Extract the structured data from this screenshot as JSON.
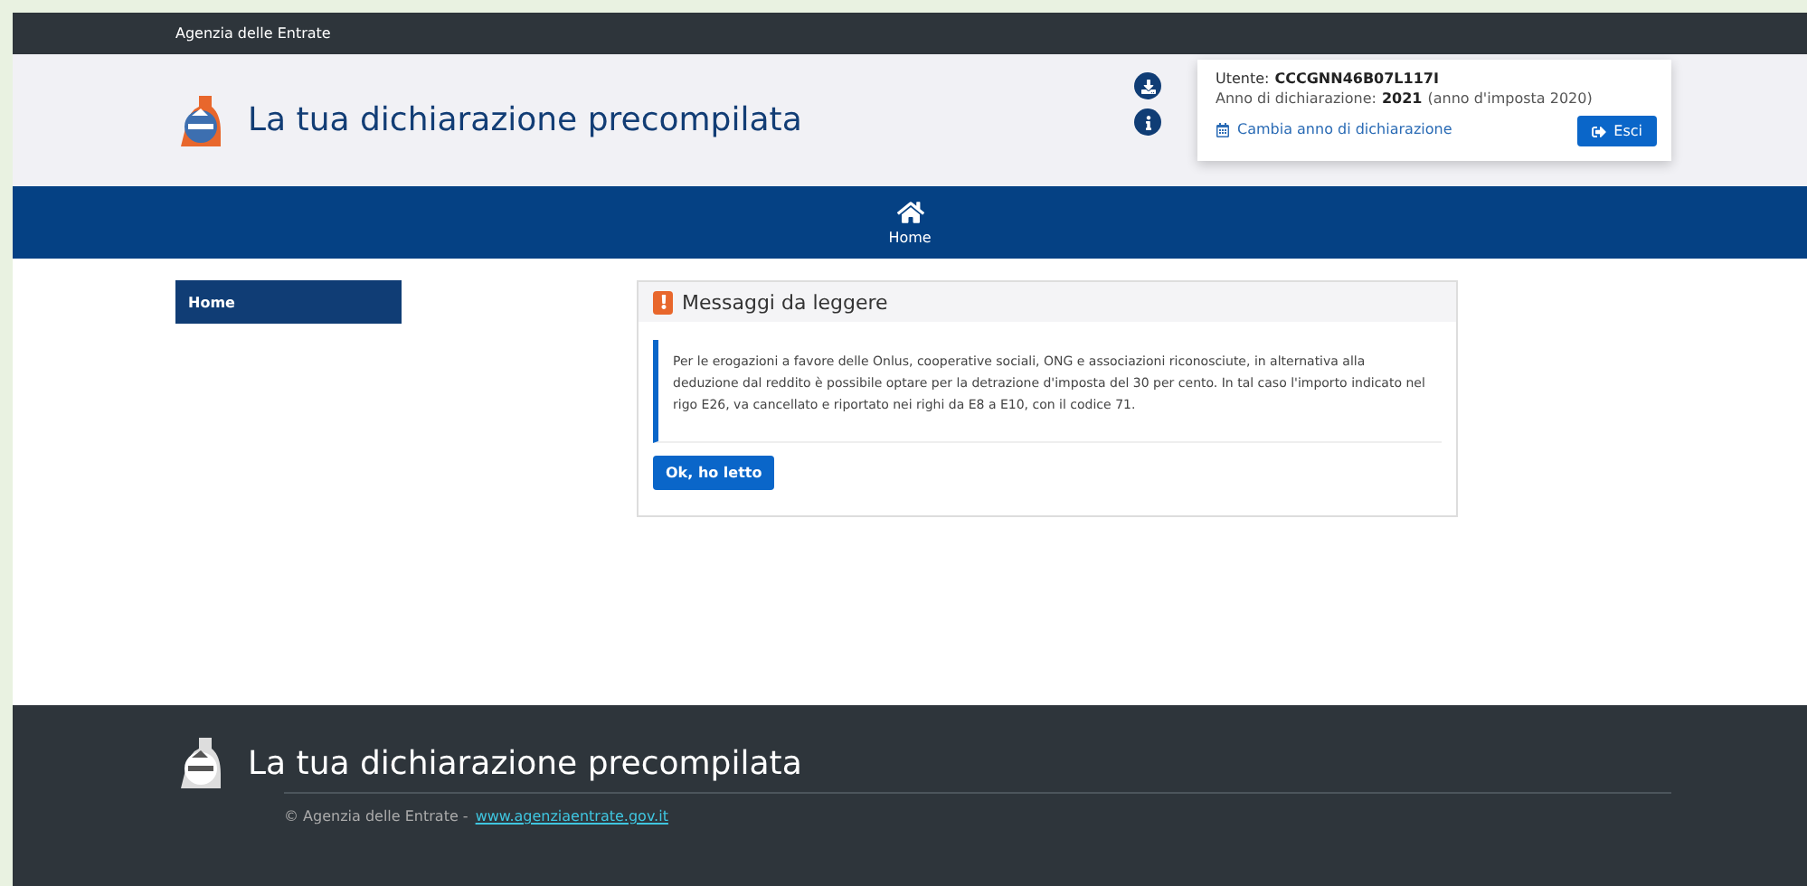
{
  "top_bar": {
    "agency": "Agenzia delle Entrate"
  },
  "header": {
    "title": "La tua dichiarazione precompilata",
    "user_label": "Utente:",
    "user_code": "CCCGNN46B07L117I",
    "year_label": "Anno di dichiarazione:",
    "year": "2021",
    "tax_year": "(anno d'imposta 2020)",
    "change_year_link": "Cambia anno di dichiarazione",
    "logout_button": "Esci"
  },
  "nav": {
    "items": [
      {
        "label": "Home",
        "selected": true
      }
    ]
  },
  "sidebar": {
    "items": [
      {
        "label": "Home",
        "selected": true
      }
    ]
  },
  "message_panel": {
    "title": "Messaggi da leggere",
    "text": "Per le erogazioni a favore delle Onlus, cooperative sociali, ONG e associazioni riconosciute, in alternativa alla deduzione dal reddito è possibile optare per la detrazione d'imposta del 30 per cento. In tal caso l'importo indicato nel rigo E26, va cancellato e riportato nei righi da E8 a E10, con il codice 71.",
    "button": "Ok, ho letto"
  },
  "footer": {
    "title": "La tua dichiarazione precompilata",
    "copyright": "© Agenzia delle Entrate -",
    "link": "www.agenziaentrate.gov.it"
  }
}
